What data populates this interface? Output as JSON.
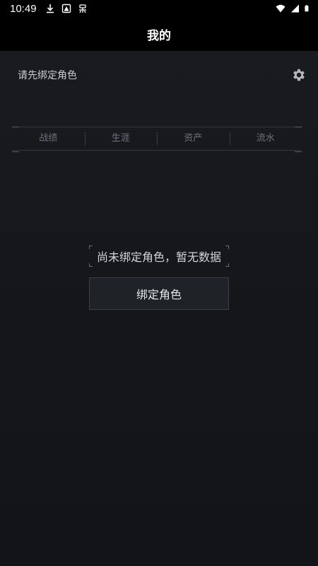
{
  "status_bar": {
    "time": "10:49",
    "left_icons": [
      "download-icon",
      "image-icon",
      "bug-icon"
    ],
    "right_icons": [
      "wifi-icon",
      "signal-icon",
      "battery-icon"
    ]
  },
  "app_bar": {
    "title": "我的"
  },
  "header": {
    "bind_prompt": "请先绑定角色",
    "settings_icon": "gear-icon"
  },
  "tabs": [
    {
      "label": "战绩"
    },
    {
      "label": "生涯"
    },
    {
      "label": "资产"
    },
    {
      "label": "流水"
    }
  ],
  "empty_state": {
    "message": "尚未绑定角色，暂无数据",
    "button_label": "绑定角色"
  },
  "colors": {
    "background": "#15171b",
    "bar": "#000000",
    "tab_text": "#6d7179",
    "button_bg": "#1f2226"
  }
}
